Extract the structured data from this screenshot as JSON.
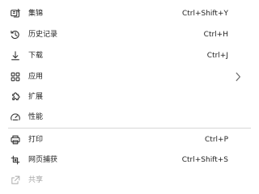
{
  "menu": {
    "items": [
      {
        "label": "集锦",
        "shortcut": "Ctrl+Shift+Y",
        "icon": "collections-icon"
      },
      {
        "label": "历史记录",
        "shortcut": "Ctrl+H",
        "icon": "history-icon"
      },
      {
        "label": "下载",
        "shortcut": "Ctrl+J",
        "icon": "download-icon"
      },
      {
        "label": "应用",
        "shortcut": "",
        "icon": "apps-icon",
        "submenu": true
      },
      {
        "label": "扩展",
        "shortcut": "",
        "icon": "extensions-icon"
      },
      {
        "label": "性能",
        "shortcut": "",
        "icon": "performance-icon"
      },
      {
        "label": "打印",
        "shortcut": "Ctrl+P",
        "icon": "print-icon"
      },
      {
        "label": "网页捕获",
        "shortcut": "Ctrl+Shift+S",
        "icon": "web-capture-icon"
      },
      {
        "label": "共享",
        "shortcut": "",
        "icon": "share-icon",
        "disabled": true
      }
    ]
  },
  "colors": {
    "background": "#ffffff",
    "text": "#1f1f1f",
    "icon": "#2f2f2f",
    "divider": "#d7d7d7",
    "disabled": "#a6a6a6"
  }
}
